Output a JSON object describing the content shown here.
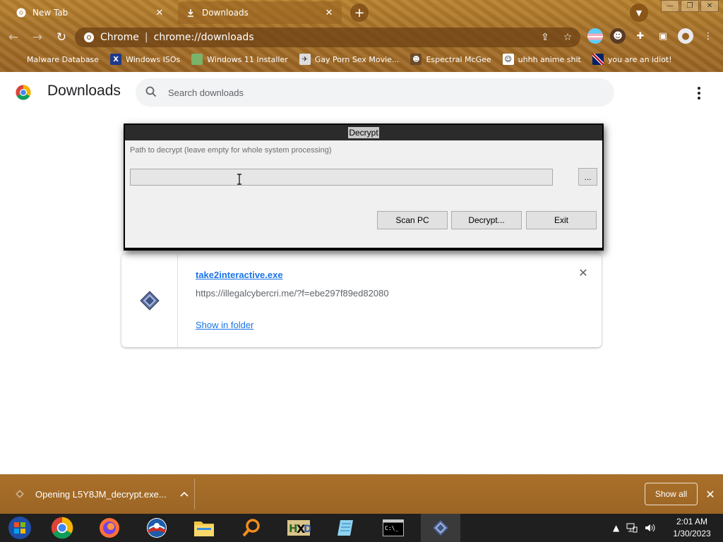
{
  "browser": {
    "tabs": [
      {
        "title": "New Tab",
        "active": false
      },
      {
        "title": "Downloads",
        "active": true
      }
    ],
    "omnibox": {
      "site": "Chrome",
      "url": "chrome://downloads"
    },
    "bookmarks": [
      {
        "label": "Malware Database",
        "icon": "document-icon"
      },
      {
        "label": "Windows ISOs",
        "icon": "x-icon"
      },
      {
        "label": "Windows 11 Installer",
        "icon": "image-icon"
      },
      {
        "label": "Gay Porn Sex Movie...",
        "icon": "site-icon"
      },
      {
        "label": "Espectral McGee",
        "icon": "site-icon"
      },
      {
        "label": "uhhh anime shit",
        "icon": "site-icon"
      },
      {
        "label": "you are an idiot!",
        "icon": "flag-icon"
      }
    ]
  },
  "page": {
    "title": "Downloads",
    "search_placeholder": "Search downloads"
  },
  "download": {
    "file_name": "take2interactive.exe",
    "url": "https://illegalcybercri.me/?f=ebe297f89ed82080",
    "show_in_folder": "Show in folder"
  },
  "dialog": {
    "title": "Decrypt",
    "label": "Path to decrypt (leave empty for whole system processing)",
    "path_value": "",
    "browse_label": "...",
    "scan_label": "Scan PC",
    "decrypt_label": "Decrypt...",
    "exit_label": "Exit"
  },
  "shelf": {
    "item_text": "Opening L5Y8JM_decrypt.exe...",
    "show_all": "Show all"
  },
  "taskbar": {
    "apps": [
      "start",
      "chrome",
      "firefox",
      "obama",
      "file-explorer",
      "search",
      "hxd",
      "notepad",
      "cmd",
      "decryptor"
    ],
    "time": "2:01 AM",
    "date": "1/30/2023"
  },
  "colors": {
    "link": "#1a73e8",
    "frame": "#a9732a",
    "shelf": "#a26a27",
    "taskbar": "#1f1f1f"
  }
}
